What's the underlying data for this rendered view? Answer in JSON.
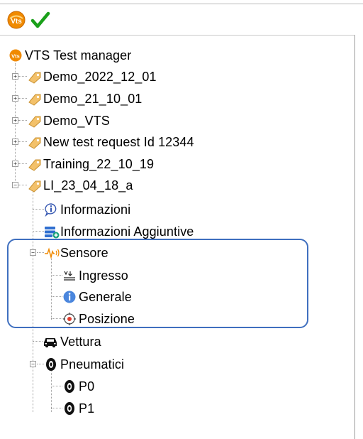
{
  "toolbar": {
    "vts_icon": "vts-logo-icon",
    "confirm_icon": "checkmark-icon",
    "confirm_color": "#1aa01a"
  },
  "tree": {
    "root": {
      "label": "VTS Test manager",
      "icon": "vts-logo-icon"
    },
    "requests": [
      {
        "label": "Demo_2022_12_01",
        "expander": "+"
      },
      {
        "label": "Demo_21_10_01",
        "expander": "+"
      },
      {
        "label": "Demo_VTS",
        "expander": "+"
      },
      {
        "label": "New test request Id 12344",
        "expander": "+"
      },
      {
        "label": "Training_22_10_19",
        "expander": "+"
      },
      {
        "label": "LI_23_04_18_a",
        "expander": "−"
      }
    ],
    "selected_request_children": {
      "informazioni": {
        "label": "Informazioni",
        "icon": "info-bubble-icon"
      },
      "informazioni_aggiuntive": {
        "label": "Informazioni Aggiuntive",
        "icon": "database-add-icon"
      },
      "sensore": {
        "label": "Sensore",
        "icon": "sensor-wave-icon",
        "expander": "−",
        "children": {
          "ingresso": {
            "label": "Ingresso",
            "icon": "input-icon"
          },
          "generale": {
            "label": "Generale",
            "icon": "info-circle-icon"
          },
          "posizione": {
            "label": "Posizione",
            "icon": "target-icon"
          }
        }
      },
      "vettura": {
        "label": "Vettura",
        "icon": "car-icon"
      },
      "pneumatici": {
        "label": "Pneumatici",
        "icon": "tire-icon",
        "expander": "−",
        "children": {
          "p0": {
            "label": "P0",
            "icon": "tire-icon"
          },
          "p1": {
            "label": "P1",
            "icon": "tire-icon"
          }
        }
      }
    },
    "highlight_color": "#3f6fbf"
  }
}
